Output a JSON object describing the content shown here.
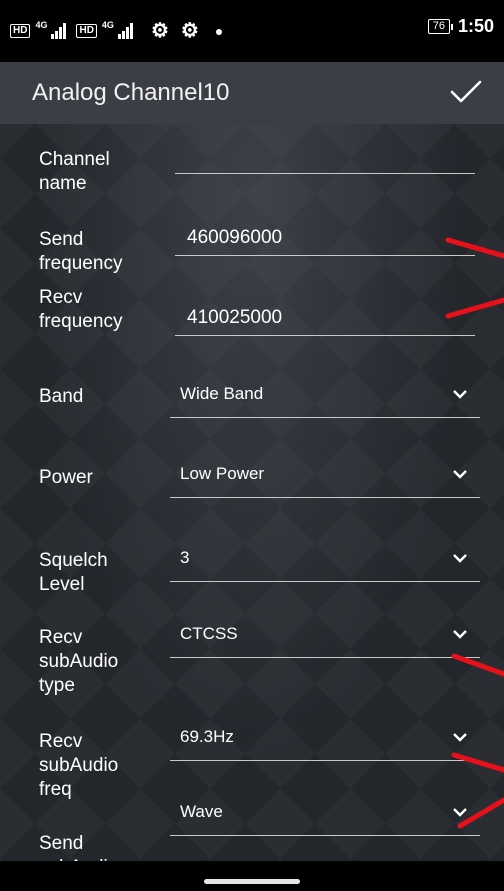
{
  "status_bar": {
    "sim1_hd": "HD",
    "sim1_net": "4G",
    "sim2_hd": "HD",
    "sim2_net": "4G",
    "battery": "76",
    "time": "1:50"
  },
  "header": {
    "title": "Analog Channel10"
  },
  "form": {
    "channel_name": {
      "label": "Channel name",
      "value": ""
    },
    "send_frequency": {
      "label": "Send frequency",
      "value": "460096000"
    },
    "recv_frequency": {
      "label": "Recv frequency",
      "value": "410025000"
    },
    "band": {
      "label": "Band",
      "value": "Wide Band"
    },
    "power": {
      "label": "Power",
      "value": "Low Power"
    },
    "squelch_level": {
      "label": "Squelch Level",
      "value": "3"
    },
    "recv_subaudio_type": {
      "label": "Recv subAudio type",
      "value": "CTCSS"
    },
    "recv_subaudio_freq": {
      "label": "Recv subAudio freq",
      "value": "69.3Hz"
    },
    "send_subaudio": {
      "label": "Send subAudio",
      "value": "Wave"
    }
  },
  "colors": {
    "app_bar": "#3b3f45",
    "background": "#23272c",
    "annotation": "#e8101a"
  },
  "icons": {
    "confirm": "check-icon",
    "dropdown": "chevron-down-icon",
    "settings": "gear-icon"
  }
}
